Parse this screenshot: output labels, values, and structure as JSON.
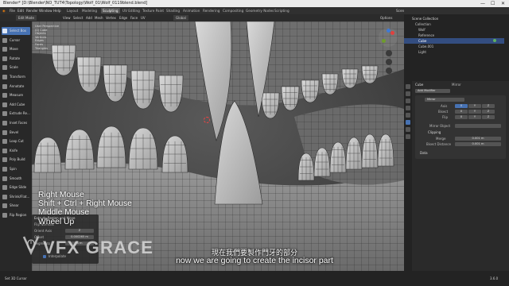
{
  "window": {
    "title": "Blender* [D:\\Blender\\NO_TUT4\\Topology\\Wolf_01\\Wolf_0119blend.blend]",
    "controls": [
      "—",
      "☐",
      "✕"
    ]
  },
  "menu": {
    "items": [
      "File",
      "Edit",
      "Render",
      "Window",
      "Help"
    ],
    "workspaces": [
      "Layout",
      "Modeling",
      "Sculpting",
      "UV Editing",
      "Texture Paint",
      "Shading",
      "Animation",
      "Rendering",
      "Compositing",
      "Geometry Nodes",
      "Scripting"
    ],
    "active_workspace": "Sculpting",
    "scene": "Scene",
    "view_layer": "ViewLayer"
  },
  "header": {
    "mode": "Edit Mode",
    "menus": [
      "View",
      "Select",
      "Add",
      "Mesh",
      "Vertex",
      "Edge",
      "Face",
      "UV"
    ],
    "transform": "Global",
    "options": "Options"
  },
  "viewport_info": {
    "lines": [
      "User Perspective",
      "(0) Cube",
      "Objects",
      "Vertices",
      "Edges",
      "Faces",
      "Triangles"
    ]
  },
  "toolbar": {
    "tools": [
      {
        "label": "Select Box",
        "active": true
      },
      {
        "label": "Cursor",
        "active": false
      },
      {
        "label": "Move",
        "active": false
      },
      {
        "label": "Rotate",
        "active": false
      },
      {
        "label": "Scale",
        "active": false
      },
      {
        "label": "Transform",
        "active": false
      },
      {
        "label": "Annotate",
        "active": false
      },
      {
        "label": "Measure",
        "active": false
      },
      {
        "label": "Add Cube",
        "active": false
      },
      {
        "label": "Extrude Re...",
        "active": false
      },
      {
        "label": "Inset Faces",
        "active": false
      },
      {
        "label": "Bevel",
        "active": false
      },
      {
        "label": "Loop Cut",
        "active": false
      },
      {
        "label": "Knife",
        "active": false
      },
      {
        "label": "Poly Build",
        "active": false
      },
      {
        "label": "Spin",
        "active": false
      },
      {
        "label": "Smooth",
        "active": false
      },
      {
        "label": "Edge Slide",
        "active": false
      },
      {
        "label": "Shrink/Flat...",
        "active": false
      },
      {
        "label": "Shear",
        "active": false
      },
      {
        "label": "Rip Region",
        "active": false
      }
    ]
  },
  "keys": [
    "Right Mouse",
    "Shift + Ctrl + Right Mouse",
    "Middle Mouse",
    "Wheel Up"
  ],
  "redo_panel": {
    "title": "Extrude Region and Move",
    "rows": [
      {
        "label": "Flip Normals",
        "value": ""
      },
      {
        "label": "Orient Axis",
        "value": "Z"
      },
      {
        "label": "Offset",
        "value": "0.000265 m"
      },
      {
        "label": "Segments",
        "value": "8 m"
      },
      {
        "label": "Interpolate",
        "value": ""
      }
    ]
  },
  "brand": {
    "text": "VFX GRACE"
  },
  "subtitles": {
    "zh": "現在我們要製作門牙的部分",
    "en": "now we are going to create the incisor part"
  },
  "outliner": {
    "header": "Scene Collection",
    "rows": [
      {
        "label": "Collection",
        "selected": false
      },
      {
        "label": "Wolf",
        "selected": false
      },
      {
        "label": "Reference",
        "selected": false
      },
      {
        "label": "Cube",
        "selected": true
      },
      {
        "label": "Cube.001",
        "selected": false
      },
      {
        "label": "Light",
        "selected": false
      }
    ]
  },
  "properties": {
    "object": "Cube",
    "modifier_type": "Mirror",
    "add_modifier": "Add Modifier",
    "mirror_name": "Mirror",
    "axis_rows": [
      {
        "label": "Axis",
        "values": [
          "X",
          "Y",
          "Z"
        ]
      },
      {
        "label": "Bisect",
        "values": [
          "X",
          "Y",
          "Z"
        ]
      },
      {
        "label": "Flip",
        "values": [
          "X",
          "Y",
          "Z"
        ]
      }
    ],
    "mirror_object_label": "Mirror Object",
    "clipping": "Clipping",
    "merge_label": "Merge",
    "merge_value": "0.001 m",
    "bisect_distance_label": "Bisect Distance",
    "bisect_distance_value": "0.001 m",
    "data_section": "Data"
  },
  "status": {
    "left": "Set 3D Cursor",
    "version": "3.6.0"
  },
  "colors": {
    "active_blue": "#4772b3",
    "selection": "#334d80",
    "mesh_grey": "#bfbfbf",
    "background": "#3d3d3d"
  }
}
